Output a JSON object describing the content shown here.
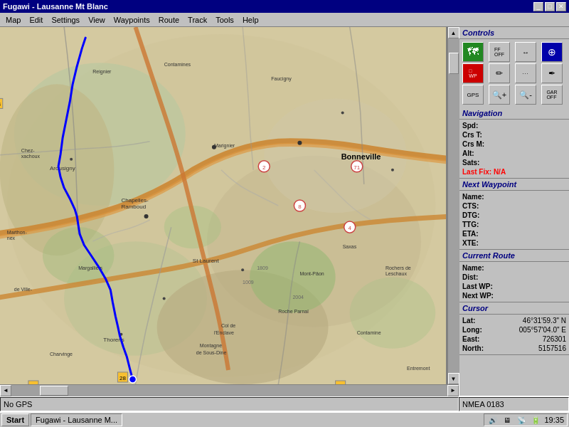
{
  "window": {
    "title": "Fugawi - Lausanne Mt Blanc"
  },
  "titlebar": {
    "minimize": "_",
    "maximize": "□",
    "close": "✕"
  },
  "menu": {
    "items": [
      "Map",
      "Edit",
      "Settings",
      "View",
      "Waypoints",
      "Route",
      "Track",
      "Tools",
      "Help"
    ]
  },
  "controls": {
    "section_title": "Controls",
    "buttons": [
      {
        "label": "🗺",
        "id": "map-btn",
        "color": "green"
      },
      {
        "label": "FF\nOFF",
        "id": "ff-btn",
        "color": "gray"
      },
      {
        "label": "↔\nOFF",
        "id": "arrows-btn",
        "color": "gray"
      },
      {
        "label": "⊕",
        "id": "compass-btn",
        "color": "blue"
      },
      {
        "label": "□\nWP",
        "id": "wp-btn",
        "color": "red"
      },
      {
        "label": "✏",
        "id": "draw-btn",
        "color": "gray"
      },
      {
        "label": "···",
        "id": "dots-btn",
        "color": "gray"
      },
      {
        "label": "✏",
        "id": "pen-btn",
        "color": "gray"
      },
      {
        "label": "GPS",
        "id": "gps-btn",
        "color": "gray"
      },
      {
        "label": "🔍+",
        "id": "zoom-in-btn",
        "color": "gray"
      },
      {
        "label": "🔍-",
        "id": "zoom-out-btn",
        "color": "gray"
      },
      {
        "label": "GAR\nOFF",
        "id": "gar-btn",
        "color": "gray"
      }
    ]
  },
  "navigation": {
    "section_title": "Navigation",
    "fields": [
      {
        "label": "Spd:",
        "value": ""
      },
      {
        "label": "Crs T:",
        "value": ""
      },
      {
        "label": "Crs M:",
        "value": ""
      },
      {
        "label": "Alt:",
        "value": ""
      },
      {
        "label": "Sats:",
        "value": ""
      },
      {
        "label": "Last Fix:",
        "value": "N/A",
        "red": true
      }
    ]
  },
  "next_waypoint": {
    "section_title": "Next Waypoint",
    "fields": [
      {
        "label": "Name:",
        "value": ""
      },
      {
        "label": "CTS:",
        "value": ""
      },
      {
        "label": "DTG:",
        "value": ""
      },
      {
        "label": "TTG:",
        "value": ""
      },
      {
        "label": "ETA:",
        "value": ""
      },
      {
        "label": "XTE:",
        "value": ""
      }
    ]
  },
  "current_route": {
    "section_title": "Current Route",
    "fields": [
      {
        "label": "Name:",
        "value": ""
      },
      {
        "label": "Dist:",
        "value": ""
      },
      {
        "label": "Last WP:",
        "value": ""
      },
      {
        "label": "Next WP:",
        "value": ""
      }
    ]
  },
  "cursor": {
    "section_title": "Cursor",
    "fields": [
      {
        "label": "Lat:",
        "value": "46°31'59.3\" N"
      },
      {
        "label": "Long:",
        "value": "005°57'04.0\" E"
      },
      {
        "label": "East:",
        "value": "726301"
      },
      {
        "label": "North:",
        "value": "5157516"
      }
    ]
  },
  "status_bar": {
    "left": "No GPS",
    "right": "NMEA 0183"
  },
  "taskbar": {
    "start_label": "Start",
    "app_label": "Fugawi - Lausanne M...",
    "time": "19:35"
  }
}
